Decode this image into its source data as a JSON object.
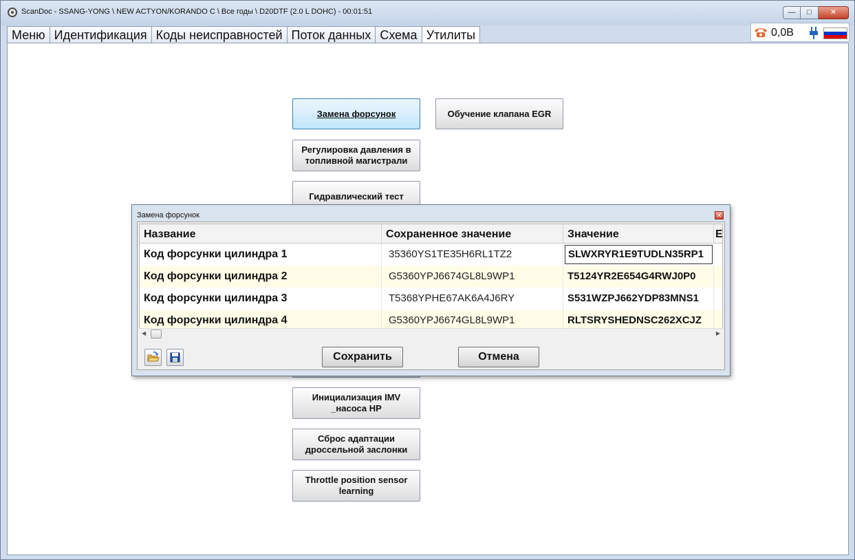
{
  "window": {
    "title": "ScanDoc - SSANG-YONG \\ NEW ACTYON/KORANDO C \\ Все годы \\ D20DTF (2.0 L DOHC) - 00:01:51"
  },
  "tabs": [
    {
      "label": "Меню"
    },
    {
      "label": "Идентификация"
    },
    {
      "label": "Коды неисправностей"
    },
    {
      "label": "Поток данных"
    },
    {
      "label": "Схема"
    },
    {
      "label": "Утилиты"
    }
  ],
  "status": {
    "voltage": "0,0В",
    "flag_colors": [
      "#ffffff",
      "#0033cc",
      "#dd0000"
    ]
  },
  "utilities": {
    "injector_replace": "Замена форсунок",
    "egr_learning": "Обучение клапана EGR",
    "rail_pressure_line1": "Регулировка давления в",
    "rail_pressure_line2": "топливной магистрали",
    "hydraulic_test": "Гидравлический тест",
    "imv_init_line1": "Инициализация IMV",
    "imv_init_line2": "_насоса HP",
    "throttle_reset_line1": "Сброс адаптации",
    "throttle_reset_line2": "дроссельной заслонки",
    "tps_learning_line1": "Throttle position sensor",
    "tps_learning_line2": "learning"
  },
  "dialog": {
    "title": "Замена форсунок",
    "columns": [
      "Название",
      "Сохраненное значение",
      "Значение",
      "E"
    ],
    "rows": [
      {
        "name": "Код форсунки цилиндра 1",
        "saved": "35360YS1TE35H6RL1TZ2",
        "value": "SLWXRYR1E9TUDLN35RP1"
      },
      {
        "name": "Код форсунки цилиндра 2",
        "saved": "G5360YPJ6674GL8L9WP1",
        "value": "T5124YR2E654G4RWJ0P0"
      },
      {
        "name": "Код форсунки цилиндра 3",
        "saved": "T5368YPHE67AK6A4J6RY",
        "value": "S531WZPJ662YDP83MNS1"
      },
      {
        "name": "Код форсунки цилиндра 4",
        "saved": "G5360YPJ6674GL8L9WP1",
        "value": "RLTSRYSHEDNSC262XCJZ"
      }
    ],
    "save_label": "Сохранить",
    "cancel_label": "Отмена"
  }
}
